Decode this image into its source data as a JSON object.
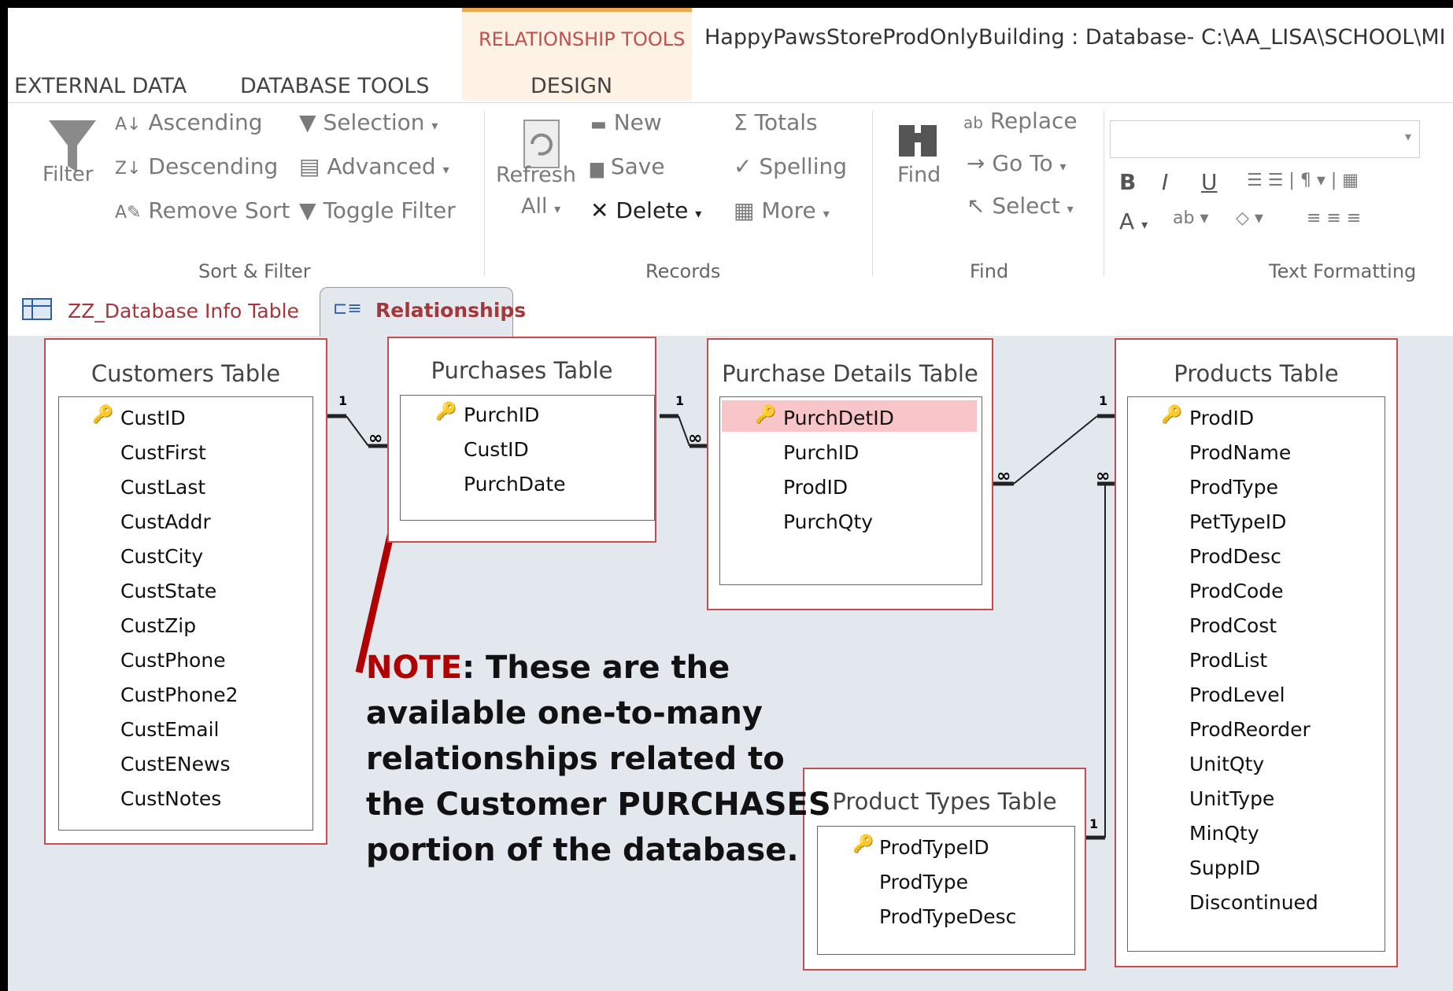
{
  "title_bar": {
    "context_tab_group": "RELATIONSHIP TOOLS",
    "window_title": "HappyPawsStoreProdOnlyBuilding : Database- C:\\AA_LISA\\SCHOOL\\MI"
  },
  "ribbon_tabs": [
    "EXTERNAL DATA",
    "DATABASE TOOLS",
    "DESIGN"
  ],
  "ribbon": {
    "sort_filter": {
      "filter": "Filter",
      "ascending": "Ascending",
      "descending": "Descending",
      "remove_sort": "Remove Sort",
      "selection": "Selection",
      "advanced": "Advanced",
      "toggle_filter": "Toggle Filter",
      "group_label": "Sort & Filter"
    },
    "records": {
      "refresh": "Refresh",
      "all": "All",
      "new": "New",
      "save": "Save",
      "delete": "Delete",
      "totals": "Totals",
      "spelling": "Spelling",
      "more": "More",
      "group_label": "Records"
    },
    "find": {
      "find": "Find",
      "replace": "Replace",
      "goto": "Go To",
      "select": "Select",
      "group_label": "Find"
    },
    "text_formatting": {
      "bold": "B",
      "italic": "I",
      "underline": "U",
      "font_color": "A",
      "group_label": "Text Formatting"
    }
  },
  "doc_tabs": [
    {
      "label": "ZZ_Database Info Table",
      "active": false
    },
    {
      "label": "Relationships",
      "active": true
    }
  ],
  "tables": {
    "customers": {
      "title": "Customers Table",
      "fields": [
        "CustID",
        "CustFirst",
        "CustLast",
        "CustAddr",
        "CustCity",
        "CustState",
        "CustZip",
        "CustPhone",
        "CustPhone2",
        "CustEmail",
        "CustENews",
        "CustNotes"
      ]
    },
    "purchases": {
      "title": "Purchases Table",
      "fields": [
        "PurchID",
        "CustID",
        "PurchDate"
      ]
    },
    "purchase_details": {
      "title": "Purchase Details Table",
      "fields": [
        "PurchDetID",
        "PurchID",
        "ProdID",
        "PurchQty"
      ]
    },
    "products": {
      "title": "Products Table",
      "fields": [
        "ProdID",
        "ProdName",
        "ProdType",
        "PetTypeID",
        "ProdDesc",
        "ProdCode",
        "ProdCost",
        "ProdList",
        "ProdLevel",
        "ProdReorder",
        "UnitQty",
        "UnitType",
        "MinQty",
        "SuppID",
        "Discontinued"
      ]
    },
    "product_types": {
      "title": "Product Types Table",
      "fields": [
        "ProdTypeID",
        "ProdType",
        "ProdTypeDesc"
      ]
    }
  },
  "relationship_labels": {
    "one": "1",
    "many": "∞"
  },
  "note": {
    "highlight": "NOTE",
    "text": ": These are the available one-to-many relationships related to the Customer PURCHASES portion of the database."
  },
  "colors": {
    "table_border": "#c74b50",
    "context_tab": "#f0a84c",
    "arrow": "#b00000",
    "selected_field": "#f8c6c8"
  }
}
